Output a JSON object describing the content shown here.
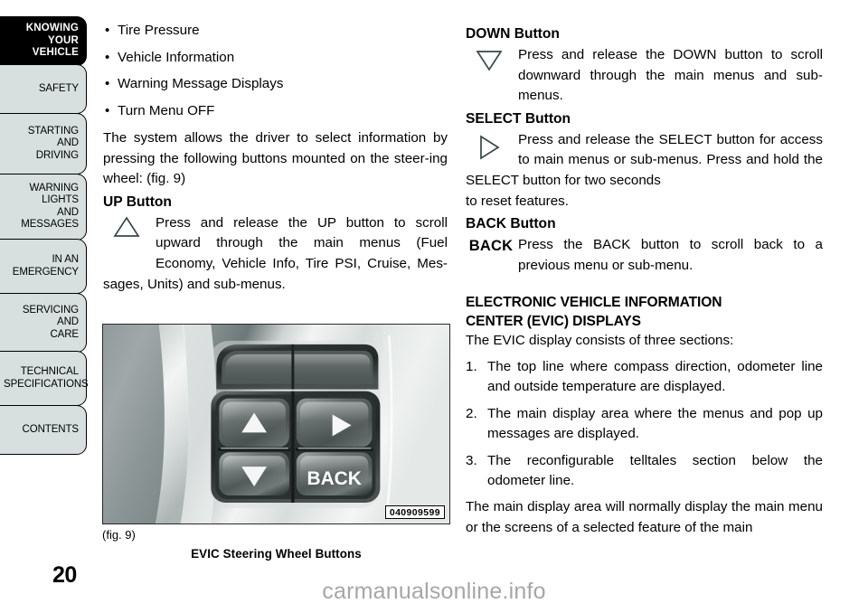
{
  "page": {
    "number": "20",
    "watermark": "carmanualsonline.info"
  },
  "sidebar": {
    "tabs": [
      {
        "name": "knowing-your-vehicle",
        "lines": [
          "KNOWING",
          "YOUR",
          "VEHICLE"
        ],
        "active": true
      },
      {
        "name": "safety",
        "lines": [
          "SAFETY"
        ],
        "active": false
      },
      {
        "name": "starting-and-driving",
        "lines": [
          "STARTING",
          "AND",
          "DRIVING"
        ],
        "active": false
      },
      {
        "name": "warning-lights-and-messages",
        "lines": [
          "WARNING",
          "LIGHTS",
          "AND",
          "MESSAGES"
        ],
        "active": false
      },
      {
        "name": "in-an-emergency",
        "lines": [
          "IN AN",
          "EMERGENCY"
        ],
        "active": false
      },
      {
        "name": "servicing-and-care",
        "lines": [
          "SERVICING",
          "AND",
          "CARE"
        ],
        "active": false
      },
      {
        "name": "technical-specifications",
        "lines": [
          "TECHNICAL",
          "SPECIFICATIONS"
        ],
        "active": false
      },
      {
        "name": "contents",
        "lines": [
          "CONTENTS"
        ],
        "active": false
      }
    ]
  },
  "left_column": {
    "bullets": [
      "Tire Pressure",
      "Vehicle Information",
      "Warning Message Displays",
      "Turn Menu OFF"
    ],
    "bullet_marker": "•",
    "intro_paragraph": "The system allows the driver to select information by pressing the following buttons mounted on the steer-ing wheel:  (fig. 9)",
    "up_button": {
      "heading": "UP Button",
      "icon": "triangle-up-outline-icon",
      "text": "Press and release the UP button to scroll upward through the main menus (Fuel Economy, Vehicle Info, Tire PSI, Cruise, Mes-sages, Units) and sub-menus."
    },
    "figure": {
      "code": "040909599",
      "number": "(fig. 9)",
      "caption": "EVIC Steering Wheel Buttons",
      "alt": "EVIC steering wheel button cluster with up arrow, right arrow, down arrow and BACK buttons",
      "button_label_back": "BACK"
    }
  },
  "right_column": {
    "down_button": {
      "heading": "DOWN Button",
      "icon": "triangle-down-outline-icon",
      "text": "Press and release the DOWN button to scroll downward through the main menus and sub-menus."
    },
    "select_button": {
      "heading": "SELECT Button",
      "icon": "triangle-right-outline-icon",
      "text": "Press and release the SELECT button for access to main menus or sub-menus. Press and hold the SELECT button for two seconds",
      "text_tail": "to reset features."
    },
    "back_button": {
      "heading": "BACK Button",
      "icon_label": "BACK",
      "text": "Press the BACK button to scroll back to a previous menu or sub-menu."
    },
    "section": {
      "title_line1": "ELECTRONIC VEHICLE INFORMATION",
      "title_line2": "CENTER (EVIC) DISPLAYS",
      "lead": "The EVIC display consists of three sections:",
      "items": [
        {
          "num": "1.",
          "text": "The top line where compass direction, odometer line and outside temperature are displayed."
        },
        {
          "num": "2.",
          "text": "The main display area where the menus and pop up messages are displayed."
        },
        {
          "num": "3.",
          "text": "The reconfigurable telltales section below the odometer line."
        }
      ],
      "closing": "The main display area will normally display the main menu or the screens of a selected feature of the main"
    }
  },
  "colors": {
    "tab_inactive_bg": "#d7dfdf",
    "tab_active_bg": "#000000",
    "text": "#000000",
    "watermark": "#a6a6a6",
    "figure_border": "#2a2a2a"
  }
}
